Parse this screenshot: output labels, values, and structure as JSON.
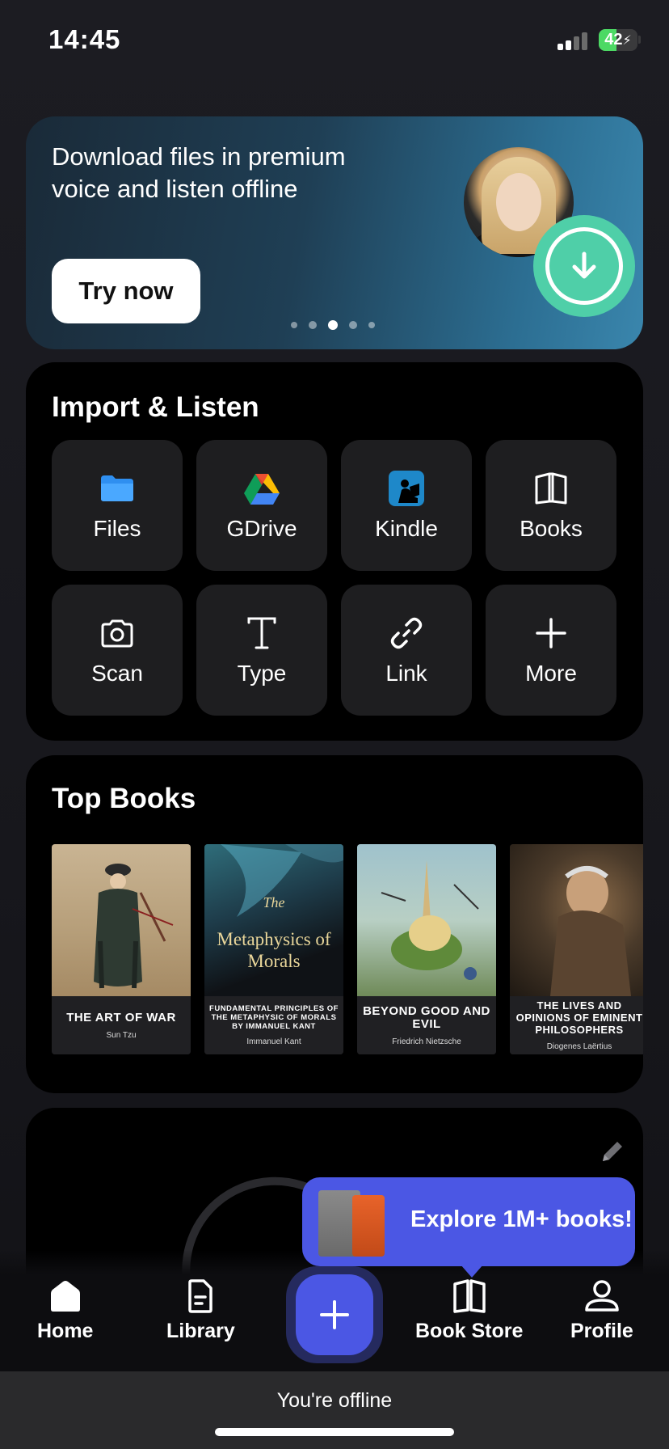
{
  "status_bar": {
    "time": "14:45",
    "battery": "42"
  },
  "promo": {
    "title": "Download files in premium voice and listen offline",
    "cta": "Try now",
    "page_count": 5,
    "active_page": 3,
    "accent": "#4fcfa8"
  },
  "import": {
    "title": "Import & Listen",
    "items": [
      {
        "label": "Files",
        "icon": "folder-icon"
      },
      {
        "label": "GDrive",
        "icon": "google-drive-icon"
      },
      {
        "label": "Kindle",
        "icon": "kindle-icon"
      },
      {
        "label": "Books",
        "icon": "open-book-icon"
      },
      {
        "label": "Scan",
        "icon": "camera-icon"
      },
      {
        "label": "Type",
        "icon": "text-icon"
      },
      {
        "label": "Link",
        "icon": "link-icon"
      },
      {
        "label": "More",
        "icon": "plus-icon"
      }
    ]
  },
  "top_books": {
    "title": "Top Books",
    "books": [
      {
        "title": "THE ART OF WAR",
        "author": "Sun Tzu"
      },
      {
        "cover_the": "The",
        "cover_title": "Metaphysics of Morals",
        "title": "FUNDAMENTAL PRINCIPLES OF THE METAPHYSIC OF MORALS BY IMMANUEL KANT",
        "author": "Immanuel Kant"
      },
      {
        "title": "BEYOND GOOD AND EVIL",
        "author": "Friedrich Nietzsche"
      },
      {
        "title": "THE LIVES AND OPINIONS OF EMINENT PHILOSOPHERS",
        "author": "Diogenes Laërtius"
      }
    ]
  },
  "tooltip": {
    "text": "Explore 1M+ books!"
  },
  "tabs": {
    "home": "Home",
    "library": "Library",
    "book_store": "Book Store",
    "profile": "Profile"
  },
  "offline_banner": "You're offline",
  "colors": {
    "brand": "#4b57e4",
    "card": "#000000",
    "tile": "#1e1e20"
  }
}
